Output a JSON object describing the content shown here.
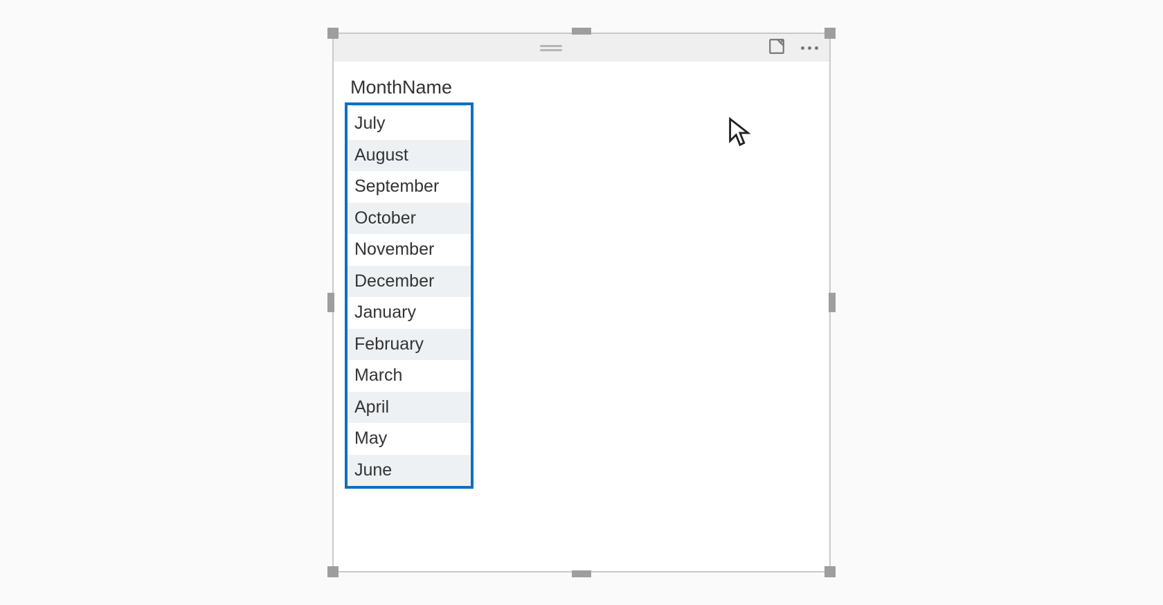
{
  "visual": {
    "header_actions": {
      "focus": "focus-mode",
      "more": "more-options"
    },
    "table": {
      "header": "MonthName",
      "rows": [
        "July",
        "August",
        "September",
        "October",
        "November",
        "December",
        "January",
        "February",
        "March",
        "April",
        "May",
        "June"
      ]
    }
  },
  "chart_data": {
    "type": "table",
    "columns": [
      "MonthName"
    ],
    "rows": [
      [
        "July"
      ],
      [
        "August"
      ],
      [
        "September"
      ],
      [
        "October"
      ],
      [
        "November"
      ],
      [
        "December"
      ],
      [
        "January"
      ],
      [
        "February"
      ],
      [
        "March"
      ],
      [
        "April"
      ],
      [
        "May"
      ],
      [
        "June"
      ]
    ]
  }
}
